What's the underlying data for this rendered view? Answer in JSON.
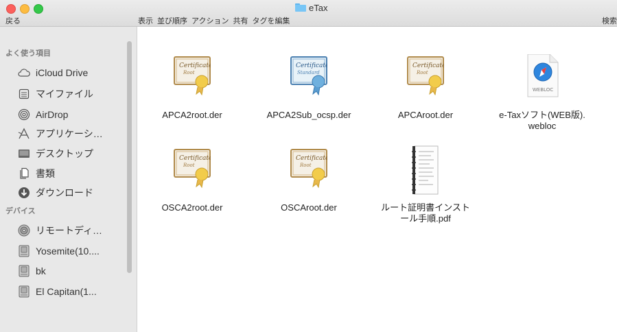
{
  "window": {
    "title": "eTax",
    "back_label": "戻る",
    "search_label": "検索"
  },
  "toolbar": {
    "items": [
      "表示",
      "並び順序",
      "アクション",
      "共有",
      "タグを編集"
    ]
  },
  "sidebar": {
    "favorites_header": "よく使う項目",
    "devices_header": "デバイス",
    "favorites": [
      {
        "label": "iCloud Drive",
        "icon": "cloud-icon"
      },
      {
        "label": "マイファイル",
        "icon": "all-files-icon"
      },
      {
        "label": "AirDrop",
        "icon": "airdrop-icon"
      },
      {
        "label": "アプリケーシ…",
        "icon": "applications-icon"
      },
      {
        "label": "デスクトップ",
        "icon": "desktop-icon"
      },
      {
        "label": "書類",
        "icon": "documents-icon"
      },
      {
        "label": "ダウンロード",
        "icon": "downloads-icon"
      }
    ],
    "devices": [
      {
        "label": "リモートディ…",
        "icon": "remote-disc-icon"
      },
      {
        "label": "Yosemite(10....",
        "icon": "disk-icon"
      },
      {
        "label": "bk",
        "icon": "disk-icon"
      },
      {
        "label": "El Capitan(1...",
        "icon": "disk-icon"
      }
    ]
  },
  "files": [
    {
      "name": "APCA2root.der",
      "icon": "certificate-root-icon"
    },
    {
      "name": "APCA2Sub_ocsp.der",
      "icon": "certificate-standard-icon"
    },
    {
      "name": "APCAroot.der",
      "icon": "certificate-root-icon"
    },
    {
      "name": "e-Taxソフト(WEB版).webloc",
      "icon": "webloc-icon"
    },
    {
      "name": "OSCA2root.der",
      "icon": "certificate-root-icon"
    },
    {
      "name": "OSCAroot.der",
      "icon": "certificate-root-icon"
    },
    {
      "name": "ルート証明書インストール手順.pdf",
      "icon": "pdf-document-icon"
    }
  ],
  "icon_text": {
    "certificate": "Certificate",
    "root": "Root",
    "standard": "Standard",
    "webloc": "WEBLOC"
  },
  "colors": {
    "sidebar_bg": "#e8e8e8",
    "toolbar_bg": "#dcdcdc",
    "folder_blue": "#78c6f6"
  }
}
